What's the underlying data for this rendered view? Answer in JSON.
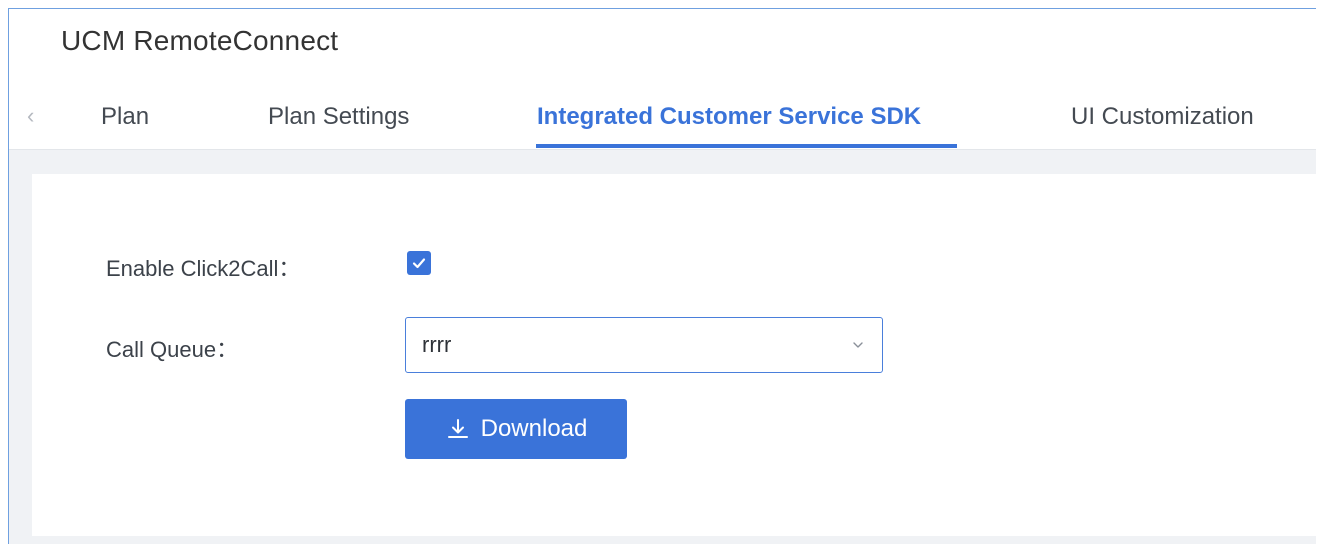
{
  "app": {
    "title": "UCM RemoteConnect"
  },
  "tabs": {
    "prev_icon": "chevron-left-icon",
    "items": [
      {
        "label": "Plan",
        "active": false
      },
      {
        "label": "Plan Settings",
        "active": false
      },
      {
        "label": "Integrated Customer Service SDK",
        "active": true
      },
      {
        "label": "UI Customization",
        "active": false
      }
    ]
  },
  "form": {
    "click2call": {
      "label": "Enable Click2Call：",
      "checked": true
    },
    "call_queue": {
      "label": "Call Queue：",
      "value": "rrrr",
      "icon": "chevron-down-icon"
    },
    "download_button": {
      "label": "Download",
      "icon": "download-icon"
    }
  },
  "colors": {
    "accent": "#3a73d9",
    "frame_border": "#6fa0e0",
    "content_bg": "#f0f2f5"
  }
}
